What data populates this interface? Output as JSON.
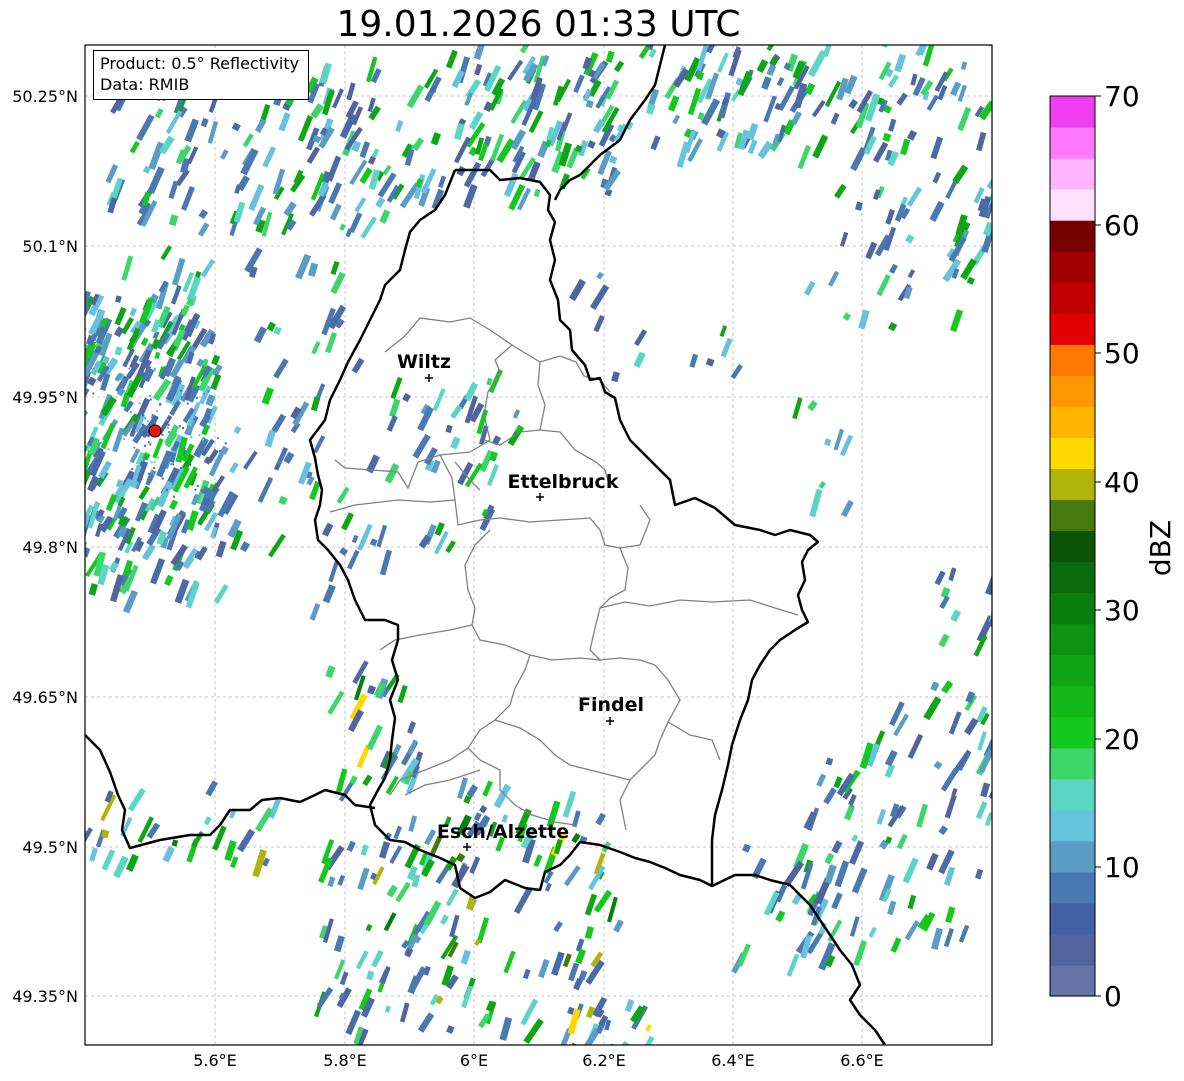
{
  "title": "19.01.2026 01:33 UTC",
  "info": {
    "product": "Product: 0.5° Reflectivity",
    "data": "Data: RMIB"
  },
  "lat_ticks": [
    "50.25°N",
    "50.1°N",
    "49.95°N",
    "49.8°N",
    "49.65°N",
    "49.5°N",
    "49.35°N"
  ],
  "lon_ticks": [
    "5.6°E",
    "5.8°E",
    "6°E",
    "6.2°E",
    "6.4°E",
    "6.6°E"
  ],
  "cities": {
    "wiltz": "Wiltz",
    "ettelbruck": "Ettelbruck",
    "findel": "Findel",
    "esch": "Esch/Alzette"
  },
  "colorbar": {
    "label": "dBZ",
    "ticks": [
      "0",
      "10",
      "20",
      "30",
      "40",
      "50",
      "60",
      "70"
    ],
    "colors": [
      "#6474a6",
      "#52649e",
      "#4360a2",
      "#4a78b0",
      "#5a9cc6",
      "#66c2de",
      "#5cd6c4",
      "#3dd66a",
      "#14c81e",
      "#12b818",
      "#0ea614",
      "#0c9412",
      "#0a7e0e",
      "#0a6a0c",
      "#0a5408",
      "#467a0c",
      "#b0b408",
      "#ffd800",
      "#ffb400",
      "#ff9800",
      "#ff7800",
      "#e00000",
      "#c00000",
      "#a00000",
      "#780000",
      "#ffe0ff",
      "#ffb4ff",
      "#ff78ff",
      "#ee3ef0"
    ]
  },
  "radar_marker_color": "#ee1111"
}
